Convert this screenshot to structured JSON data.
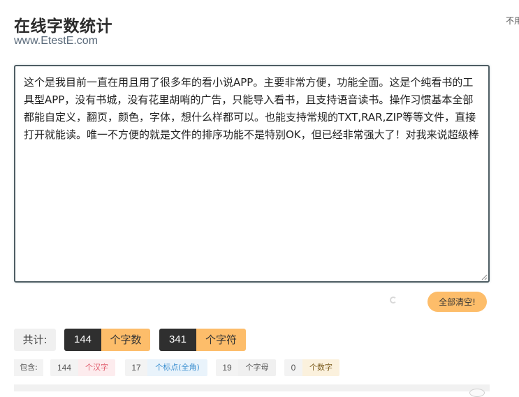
{
  "header": {
    "title": "在线字数统计",
    "subtitle": "www.EtestE.com",
    "corner_text": "不用"
  },
  "editor": {
    "value": "这个是我目前一直在用且用了很多年的看小说APP。主要非常方便，功能全面。这是个纯看书的工具型APP，没有书城，没有花里胡哨的广告，只能导入看书，且支持语音读书。操作习惯基本全部都能自定义，翻页，颜色，字体，想什么样都可以。也能支持常规的TXT,RAR,ZIP等等文件，直接打开就能读。唯一不方便的就是文件的排序功能不是特别OK，但已经非常强大了！对我来说超级棒"
  },
  "actions": {
    "clear_label": "全部清空!"
  },
  "totals": {
    "label": "共计:",
    "chars_count": "144",
    "chars_unit": "个字数",
    "symbols_count": "341",
    "symbols_unit": "个字符"
  },
  "details": {
    "label": "包含:",
    "items": [
      {
        "count": "144",
        "unit": "个汉字",
        "color": "#e05a6a",
        "bg": "#fdecee"
      },
      {
        "count": "17",
        "unit": "个标点(全角)",
        "color": "#3a8fd0",
        "bg": "#e9f3fb"
      },
      {
        "count": "19",
        "unit": "个字母",
        "color": "#555555",
        "bg": "#f0f0f0"
      },
      {
        "count": "0",
        "unit": "个数字",
        "color": "#7a5a1a",
        "bg": "#fbf1dd"
      }
    ]
  }
}
